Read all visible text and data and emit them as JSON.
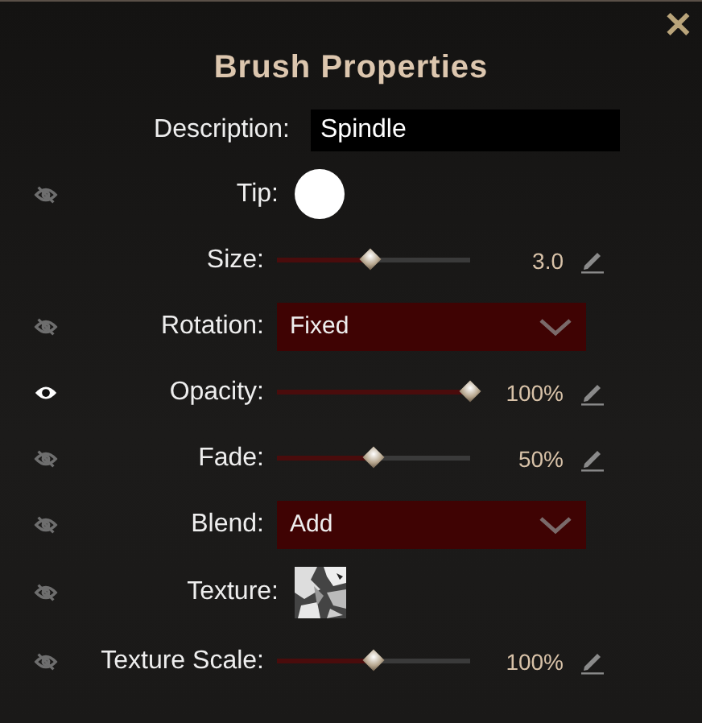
{
  "dialog": {
    "title": "Brush Properties",
    "close": "✕"
  },
  "rows": [
    {
      "kind": "text",
      "label": "Description:",
      "value": "Spindle"
    },
    {
      "kind": "tip",
      "label": "Tip:",
      "visible": false
    },
    {
      "kind": "slider",
      "label": "Size:",
      "level": 0.48,
      "reading": "3.0"
    },
    {
      "kind": "dropdown",
      "label": "Rotation:",
      "value": "Fixed",
      "visible": false
    },
    {
      "kind": "slider",
      "label": "Opacity:",
      "level": 1.0,
      "reading": "100%",
      "visible": true
    },
    {
      "kind": "slider",
      "label": "Fade:",
      "level": 0.5,
      "reading": "50%",
      "visible": false
    },
    {
      "kind": "dropdown",
      "label": "Blend:",
      "value": "Add",
      "visible": false
    },
    {
      "kind": "texture",
      "label": "Texture:",
      "visible": false
    },
    {
      "kind": "slider",
      "label": "Texture Scale:",
      "level": 0.5,
      "reading": "100%",
      "visible": false
    }
  ]
}
